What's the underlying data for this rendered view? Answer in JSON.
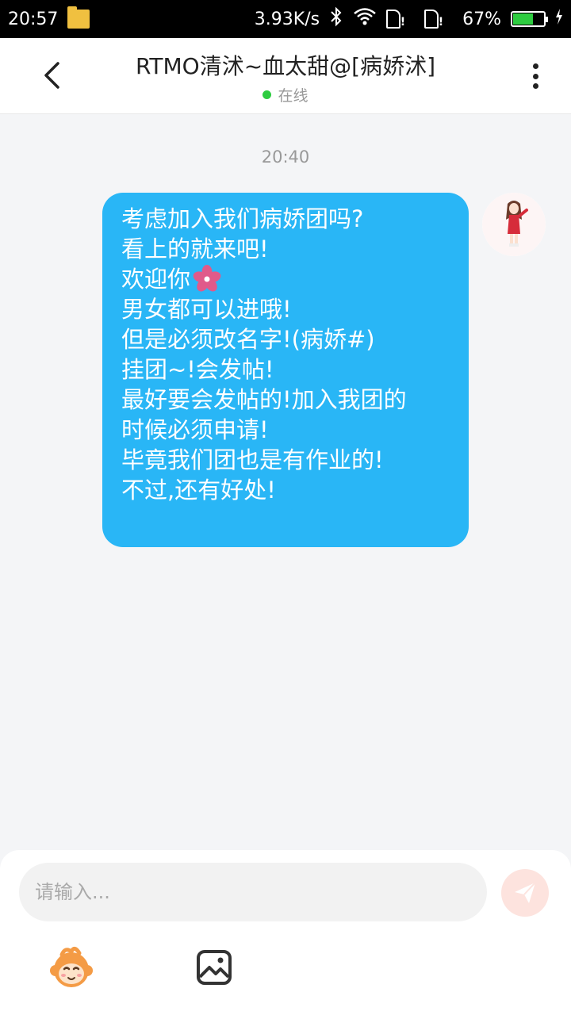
{
  "status_bar": {
    "time": "20:57",
    "network_speed": "3.93K/s",
    "battery": "67%",
    "battery_level": 0.67,
    "icons": [
      "folder-icon",
      "bluetooth-icon",
      "wifi-icon",
      "sim-icon",
      "sim-icon",
      "battery-icon",
      "charging-icon"
    ]
  },
  "header": {
    "title": "RTMO清沭~血太甜@[病娇沭]",
    "status": "在线",
    "status_color": "#2ecc40",
    "icons": [
      "back-arrow-icon",
      "more-vertical-icon"
    ]
  },
  "chat": {
    "timestamp": "20:40",
    "message": {
      "lines": [
        "考虑加入我们病娇团吗?",
        "看上的就来吧!",
        "欢迎你",
        "男女都可以进哦!",
        "但是必须改名字!(病娇#)",
        "挂团~!会发帖!",
        "最好要会发帖的!加入我团的",
        "时候必须申请!",
        "毕竟我们团也是有作业的!",
        "不过,还有好处!"
      ],
      "bubble_color": "#29b6f6",
      "inline_icon": "cherry-blossom-icon"
    }
  },
  "input_bar": {
    "placeholder": "请输入...",
    "value": "",
    "icons": [
      "send-icon",
      "emoji-monkey-icon",
      "image-icon"
    ]
  }
}
